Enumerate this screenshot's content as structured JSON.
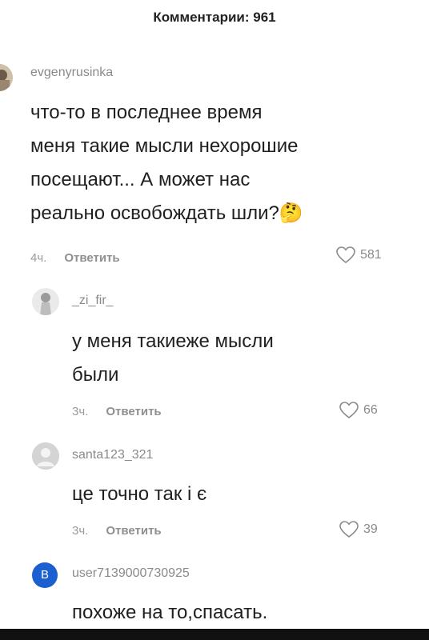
{
  "header": {
    "title": "Комментарии: 961"
  },
  "comments": [
    {
      "username": "evgenyrusinka",
      "text_lines": [
        "что-то в последнее время",
        "меня такие мысли нехорошие",
        "посещают... А может нас",
        "реально освобождать шли?"
      ],
      "emoji": "🤔",
      "time": "4ч.",
      "reply_label": "Ответить",
      "likes": "581"
    },
    {
      "username": "_zi_fir_",
      "text_lines": [
        "у меня такиеже мысли",
        "были"
      ],
      "time": "3ч.",
      "reply_label": "Ответить",
      "likes": "66"
    },
    {
      "username": "santa123_321",
      "text_lines": [
        "це точно так і є"
      ],
      "time": "3ч.",
      "reply_label": "Ответить",
      "likes": "39"
    },
    {
      "username": "user7139000730925",
      "avatar_letter": "B",
      "text_lines": [
        "похоже на то,спасать."
      ]
    }
  ],
  "colors": {
    "avatar_blue": "#1b5fd1",
    "avatar_grey": "#cfcfcf",
    "text_grey": "#8a8a8a"
  }
}
